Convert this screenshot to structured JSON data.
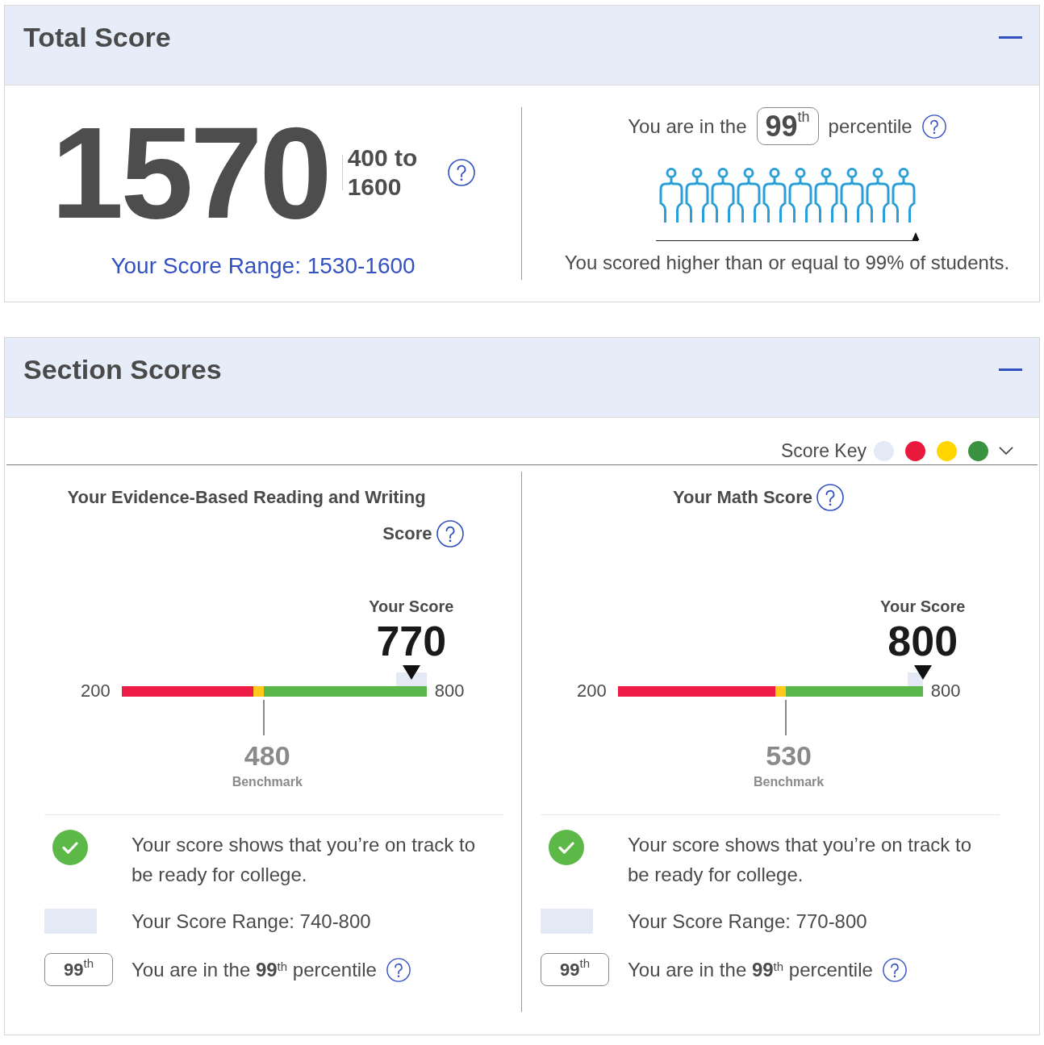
{
  "total_score": {
    "title": "Total Score",
    "expanded": true,
    "score": "1570",
    "scale": "400 to 1600",
    "score_range": "Your Score Range: 1530-1600",
    "percentile": {
      "prefix": "You are in the",
      "badge": "**99**$^{th}$",
      "suffix": "percentile",
      "level": 0.99,
      "summary": "You scored higher than or equal to 99% of students."
    }
  },
  "section_scores": {
    "title": "Section Scores",
    "expanded": true,
    "score_key": {
      "label": "Score Key",
      "expanded": false,
      "items": [
        {
          "color": "#e3eaf6"
        },
        {
          "color": "#e8193c"
        },
        {
          "color": "#ffd600"
        },
        {
          "color": "#3a9140"
        }
      ]
    },
    "sections": [
      {
        "title": "Your Evidence-Based Reading and Writing Score",
        "chart": {
          "min_label": "200",
          "max_label": "800",
          "segments": [
            {
              "color": "#ec1c46"
            },
            {
              "color": "#ffc81a"
            },
            {
              "color": "#5ab84a"
            }
          ],
          "score": {
            "label": "Your Score",
            "value": "770",
            "level": 0.95
          },
          "benchmark": {
            "value": "480",
            "label": "Benchmark",
            "level": 0.467
          }
        },
        "on_track": {
          "met": true,
          "text": "Your score shows that you’re on track to be ready for college."
        },
        "range_text": "Your Score Range: 740-800",
        "percentile_badge": "**99**$^{th}$",
        "percentile_text": "You are in the **99**$^{th}$ percentile"
      },
      {
        "title": "Your Math Score",
        "chart": {
          "min_label": "200",
          "max_label": "800",
          "segments": [
            {
              "color": "#ec1c46"
            },
            {
              "color": "#ffc81a"
            },
            {
              "color": "#5ab84a"
            }
          ],
          "score": {
            "label": "Your Score",
            "value": "800",
            "level": 1.0
          },
          "benchmark": {
            "value": "530",
            "label": "Benchmark",
            "level": 0.55
          }
        },
        "on_track": {
          "met": true,
          "text": "Your score shows that you’re on track to be ready for college."
        },
        "range_text": "Your Score Range: 770-800",
        "percentile_badge": "**99**$^{th}$",
        "percentile_text": "You are in the **99**$^{th}$ percentile"
      }
    ]
  }
}
